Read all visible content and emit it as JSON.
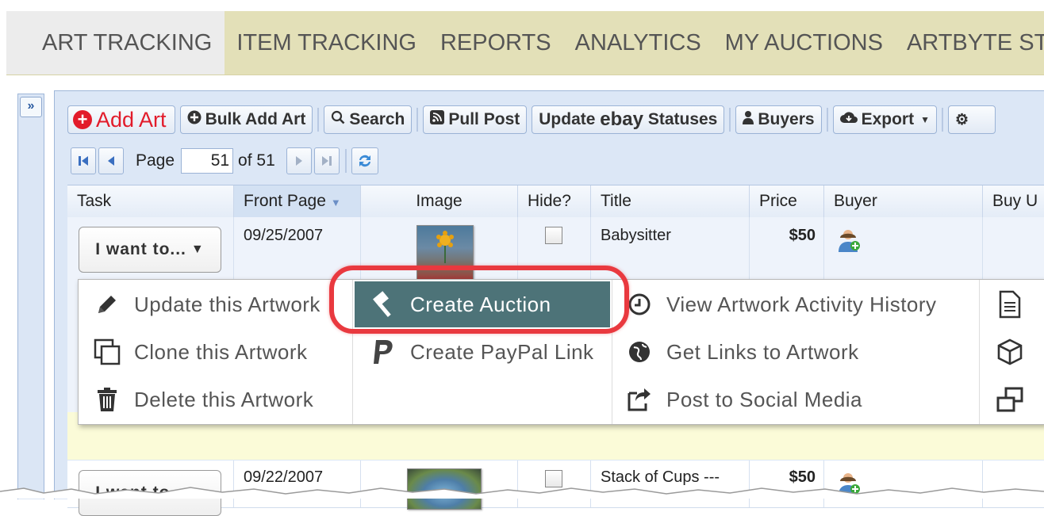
{
  "topnav": {
    "tabs": [
      {
        "label": "ART TRACKING",
        "active": true
      },
      {
        "label": "ITEM TRACKING"
      },
      {
        "label": "REPORTS"
      },
      {
        "label": "ANALYTICS"
      },
      {
        "label": "MY AUCTIONS"
      },
      {
        "label": "ARTBYTE STO"
      }
    ]
  },
  "sidebar": {
    "expand_glyph": "»"
  },
  "toolbar": {
    "add_art": "Add Art",
    "bulk_add_art": "Bulk Add Art",
    "search": "Search",
    "pull_post": "Pull Post",
    "update_ebay_prefix": "Update",
    "update_ebay_brand": "ebay",
    "update_ebay_suffix": "Statuses",
    "buyers": "Buyers",
    "export": "Export"
  },
  "pager": {
    "page_label": "Page",
    "page_value": "51",
    "of_label": "of 51"
  },
  "grid": {
    "columns": [
      "Task",
      "Front Page",
      "Image",
      "Hide?",
      "Title",
      "Price",
      "Buyer",
      "Buy U"
    ],
    "sorted_column": "Front Page",
    "rows": [
      {
        "task": "I want to...",
        "front_page": "09/25/2007",
        "title": "Babysitter",
        "price": "$50"
      },
      {
        "task": "I want to...",
        "front_page": "09/22/2007",
        "title": "Stack of Cups ---",
        "price": "$50"
      }
    ]
  },
  "context_menu": {
    "col1": [
      "Update this Artwork",
      "Clone this Artwork",
      "Delete this Artwork"
    ],
    "col2": [
      "Create Auction",
      "Create PayPal Link"
    ],
    "col3": [
      "View Artwork Activity History",
      "Get Links to Artwork",
      "Post to Social Media"
    ],
    "highlighted": "Create Auction"
  },
  "colors": {
    "nav_bg": "#e3e0b8",
    "highlight": "#4d7378",
    "callout": "#e9393f",
    "add_red": "#e21b2a"
  }
}
